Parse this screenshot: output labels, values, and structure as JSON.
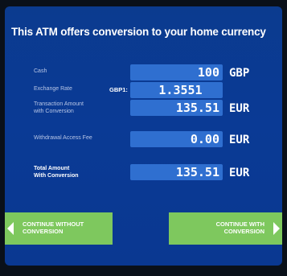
{
  "header": {
    "title": "This ATM offers conversion to your home currency"
  },
  "rows": {
    "cash": {
      "label": "Cash",
      "value": "100",
      "currency": "GBP"
    },
    "rate": {
      "label": "Exchange Rate",
      "currency_label": "GBP1:",
      "value": "1.3551"
    },
    "transaction": {
      "label_line1": "Transaction Amount",
      "label_line2": "with Conversion",
      "value": "135.51",
      "currency": "EUR"
    },
    "fee": {
      "label": "Withdrawal Access Fee",
      "value": "0.00",
      "currency": "EUR"
    },
    "total": {
      "label_line1": "Total Amount",
      "label_line2": "With Conversion",
      "value": "135.51",
      "currency": "EUR"
    }
  },
  "buttons": {
    "without": {
      "line1": "CONTINUE WITHOUT",
      "line2": "CONVERSION"
    },
    "with": {
      "line1": "CONTINUE WITH",
      "line2": "CONVERSION"
    }
  },
  "colors": {
    "screen_bg": "#0a3a95",
    "value_box": "#2f6fd0",
    "button": "#7ec85e"
  }
}
